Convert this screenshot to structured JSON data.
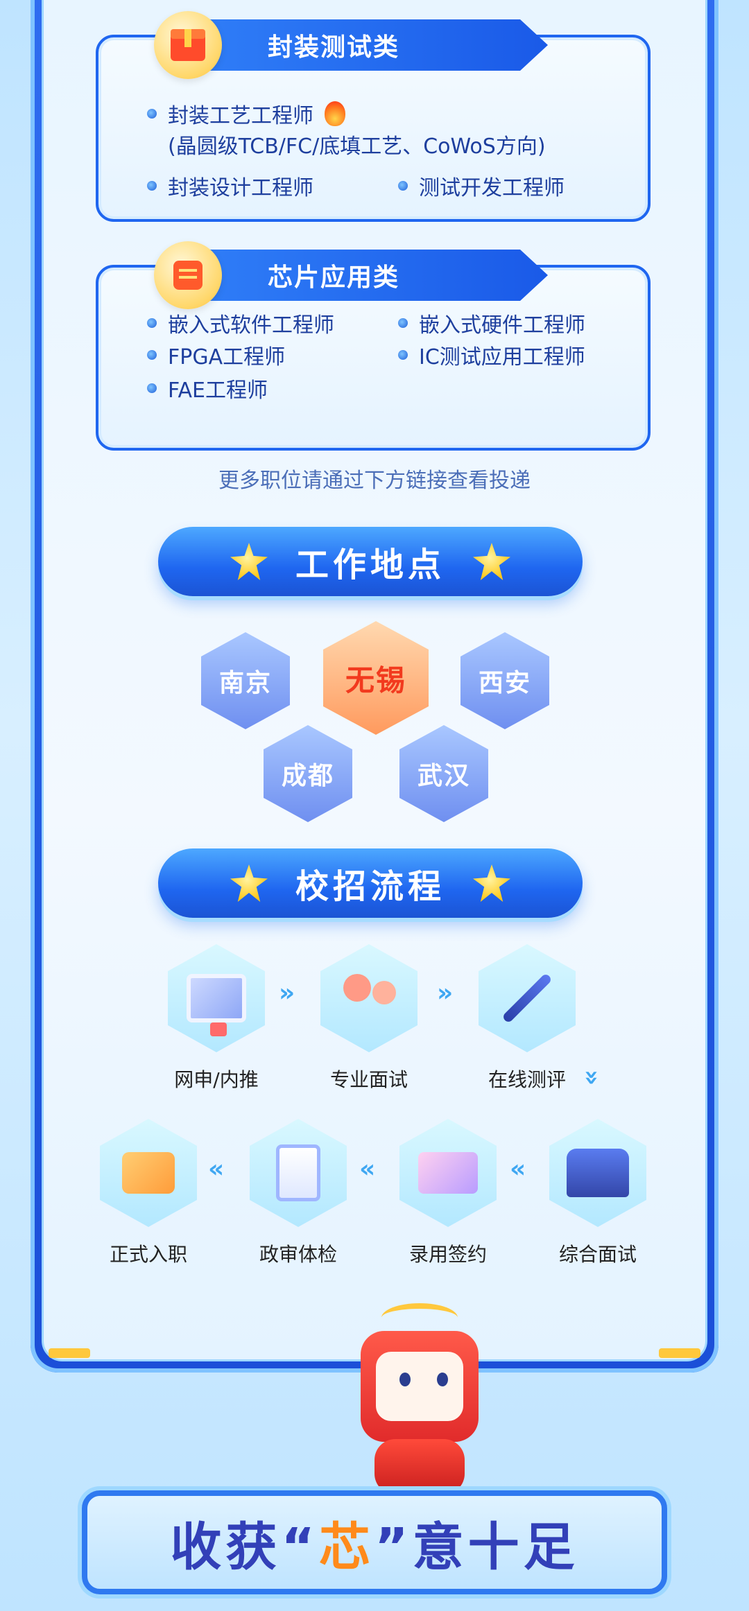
{
  "packaging_section": {
    "title": "封装测试类",
    "icon": "box-icon",
    "jobs": [
      {
        "label": "封装工艺工程师",
        "note": "(晶圆级TCB/FC/底填工艺、CoWoS方向)",
        "hot": true
      },
      {
        "label": "封装设计工程师"
      },
      {
        "label": "测试开发工程师"
      }
    ]
  },
  "chip_app_section": {
    "title": "芯片应用类",
    "icon": "document-icon",
    "jobs": [
      {
        "label": "嵌入式软件工程师"
      },
      {
        "label": "嵌入式硬件工程师"
      },
      {
        "label": "FPGA工程师"
      },
      {
        "label": "IC测试应用工程师"
      },
      {
        "label": "FAE工程师"
      }
    ]
  },
  "more_note": "更多职位请通过下方链接查看投递",
  "work_location": {
    "title": "工作地点",
    "cities": [
      "南京",
      "无锡",
      "西安",
      "成都",
      "武汉"
    ],
    "highlighted": "无锡"
  },
  "process": {
    "title": "校招流程",
    "steps": [
      "网申/内推",
      "专业面试",
      "在线测评",
      "综合面试",
      "录用签约",
      "政审体检",
      "正式入职"
    ]
  },
  "banner": {
    "prefix": "收获“",
    "highlight": "芯",
    "suffix": "”意十足"
  },
  "colors": {
    "accent": "#1f66f0",
    "highlight": "#ff8a1a",
    "active_city": "#f23a1e"
  }
}
